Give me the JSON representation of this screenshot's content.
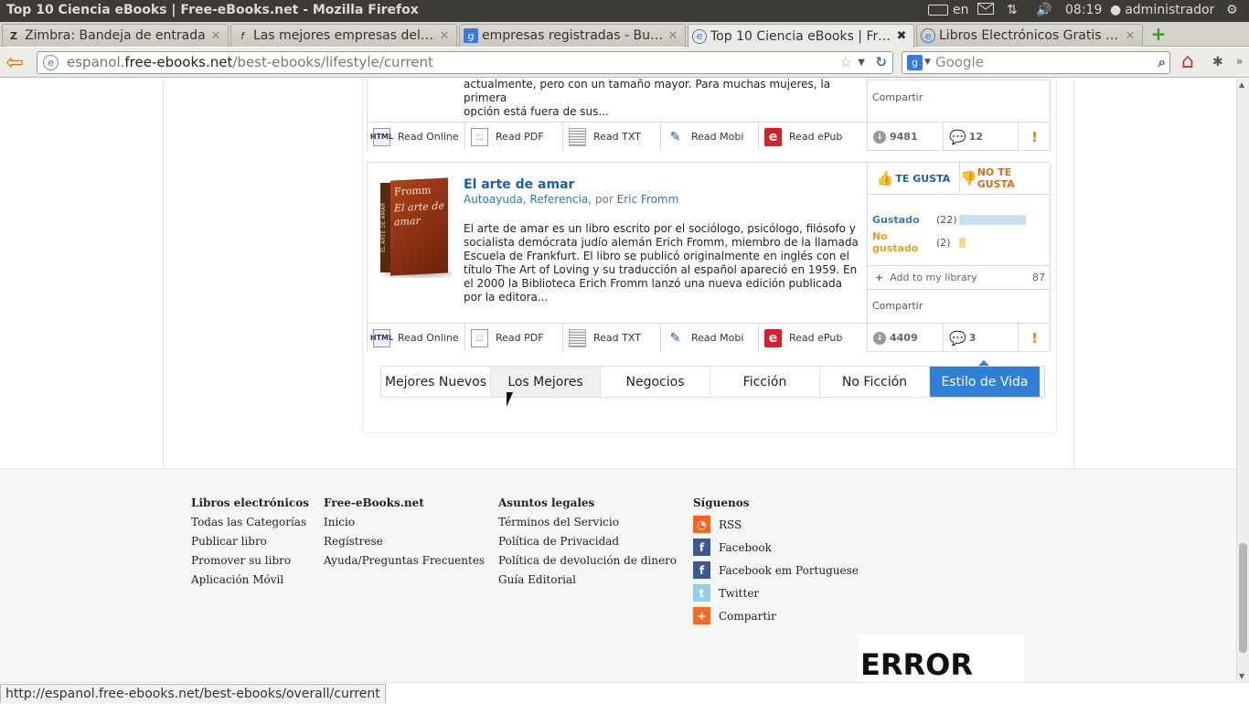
{
  "window_title": "Top 10 Ciencia eBooks | Free-eBooks.net - Mozilla Firefox",
  "indicators": {
    "lang": "en",
    "time": "08:19",
    "user": "administrador"
  },
  "tabs": [
    {
      "label": "Zimbra: Bandeja de entrada",
      "icon": "Z"
    },
    {
      "label": "Las mejores empresas del ...",
      "icon": "f"
    },
    {
      "label": "empresas registradas - Bus...",
      "icon": "g"
    },
    {
      "label": "Top 10 Ciencia eBooks | Fre...",
      "icon": "e"
    },
    {
      "label": "Libros Electrónicos Gratis p...",
      "icon": "e"
    }
  ],
  "url": {
    "prefix": "espanol.",
    "domain": "free-ebooks.net",
    "path": "/best-ebooks/lifestyle/current"
  },
  "search_placeholder": "Google",
  "book_prev": {
    "desc_line1": "actualmente, pero con un tamaño mayor. Para muchas mujeres, la primera",
    "desc_line2": "opción está fuera de sus...",
    "share": "Compartir",
    "downloads": "9481",
    "comments": "12"
  },
  "book": {
    "title": "El arte de amar",
    "categories": "Autoayuda, Referencia",
    "por": ", por",
    "author": "Eric Fromm",
    "cover_author": "Fromm",
    "cover_title": "El arte de amar",
    "cover_spine": "EL ARTE DE AMAR",
    "description": "El arte de amar es un libro escrito por el sociólogo, psicólogo, filósofo y socialista demócrata judío alemán Erich Fromm, miembro de la llamada Escuela de Frankfurt. El libro se publicó originalmente en inglés con el título The Art of Loving y su traducción al español apareció en 1959. En el 2000 la Biblioteca Erich Fromm lanzó una nueva edición publicada por la editora...",
    "like": "TE GUSTA",
    "dislike": "NO TE GUSTA",
    "liked_label": "Gustado",
    "liked_count": "(22)",
    "disliked_label": "No gustado",
    "disliked_count": "(2)",
    "liked_value": 22,
    "disliked_value": 2,
    "add_library": "Add to my library",
    "library_count": "87",
    "share": "Compartir",
    "downloads": "4409",
    "comments": "3"
  },
  "read_buttons": {
    "online": "Read Online",
    "pdf": "Read PDF",
    "txt": "Read TXT",
    "mobi": "Read Mobi",
    "epub": "Read ePub"
  },
  "icon_labels": {
    "html": "HTML",
    "epub": "e"
  },
  "report_mark": "!",
  "categories": [
    "Mejores Nuevos",
    "Los Mejores",
    "Negocios",
    "Ficción",
    "No Ficción",
    "Estilo de Vida"
  ],
  "footer": {
    "col1": {
      "title": "Libros electrónicos",
      "links": [
        "Todas las Categorías",
        "Publicar libro",
        "Promover su libro",
        "Aplicación Móvil"
      ]
    },
    "col2": {
      "title": "Free-eBooks.net",
      "links": [
        "Inicio",
        "Regístrese",
        "Ayuda/Preguntas Frecuentes"
      ]
    },
    "col3": {
      "title": "Asuntos legales",
      "links": [
        "Términos del Servicio",
        "Política de Privacidad",
        "Política de devolución de dinero",
        "Guía Editorial"
      ]
    },
    "col4": {
      "title": "Síguenos",
      "links": [
        "RSS",
        "Facebook",
        "Facebook em Portuguese",
        "Twitter",
        "Compartir"
      ]
    }
  },
  "error_text": "ERROR",
  "status_url": "http://espanol.free-ebooks.net/best-ebooks/overall/current",
  "colors": {
    "accent": "#2f7fd4",
    "like": "#1b5fa7",
    "dislike": "#e06a17",
    "liked_bar": "#c6e2ef",
    "disliked_bar": "#fbd889"
  }
}
